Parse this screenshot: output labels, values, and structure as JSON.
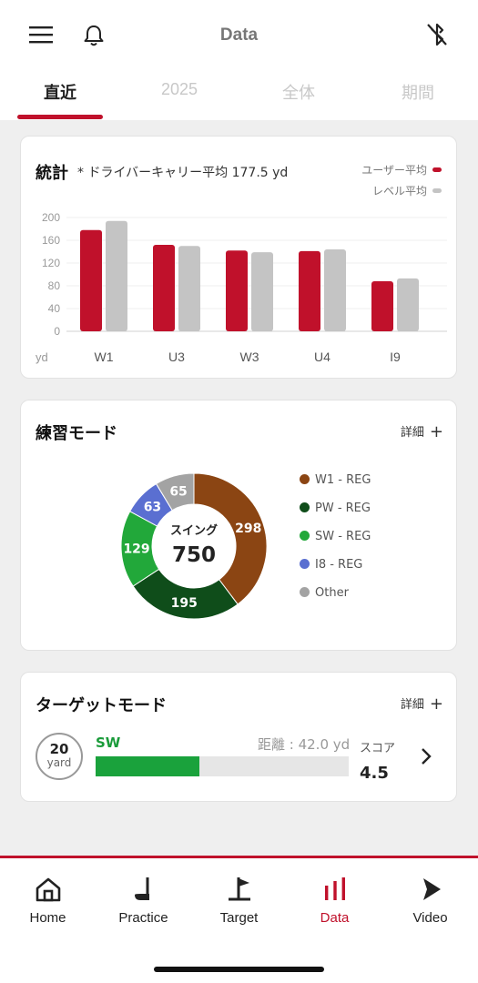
{
  "header": {
    "title": "Data",
    "icons": [
      "menu-icon",
      "bell-icon",
      "bluetooth-off-icon"
    ]
  },
  "tabs": [
    {
      "label": "直近",
      "active": true
    },
    {
      "label": "2025",
      "active": false
    },
    {
      "label": "全体",
      "active": false
    },
    {
      "label": "期間",
      "active": false
    }
  ],
  "stats": {
    "title": "統計",
    "subtitle": "* ドライバーキャリー平均 177.5 yd",
    "legend": {
      "user": "ユーザー平均",
      "level": "レベル平均"
    },
    "unit": "yd",
    "colors": {
      "user": "#c0112b",
      "level": "#c4c4c4"
    }
  },
  "chart_data": {
    "type": "bar",
    "categories": [
      "W1",
      "U3",
      "W3",
      "U4",
      "I9"
    ],
    "series": [
      {
        "name": "ユーザー平均",
        "values": [
          178,
          152,
          142,
          141,
          88
        ]
      },
      {
        "name": "レベル平均",
        "values": [
          194,
          150,
          139,
          144,
          93
        ]
      }
    ],
    "yticks": [
      0,
      40,
      80,
      120,
      160,
      200
    ],
    "ylim": [
      0,
      200
    ],
    "xlabel": "yd",
    "grid": true,
    "legend": "top-right"
  },
  "practice": {
    "title": "練習モード",
    "detail_label": "詳細",
    "center_label": "スイング",
    "center_value": "750",
    "segments": [
      {
        "label": "W1 - REG",
        "value": 298,
        "color": "#8b4513"
      },
      {
        "label": "PW - REG",
        "value": 195,
        "color": "#0f4d1a"
      },
      {
        "label": "SW - REG",
        "value": 129,
        "color": "#22a83a"
      },
      {
        "label": "I8 - REG",
        "value": 63,
        "color": "#5a6fd1"
      },
      {
        "label": "Other",
        "value": 65,
        "color": "#a3a3a3"
      }
    ]
  },
  "target": {
    "title": "ターゲットモード",
    "detail_label": "詳細",
    "yard_value": "20",
    "yard_unit": "yard",
    "club": "SW",
    "distance": "距離 : 42.0 yd",
    "progress": 0.41,
    "score_label": "スコア",
    "score_value": "4.5"
  },
  "nav": [
    {
      "label": "Home",
      "icon": "home-icon",
      "active": false
    },
    {
      "label": "Practice",
      "icon": "golf-club-icon",
      "active": false
    },
    {
      "label": "Target",
      "icon": "golf-flag-icon",
      "active": false
    },
    {
      "label": "Data",
      "icon": "bar-chart-icon",
      "active": true
    },
    {
      "label": "Video",
      "icon": "play-icon",
      "active": false
    }
  ]
}
